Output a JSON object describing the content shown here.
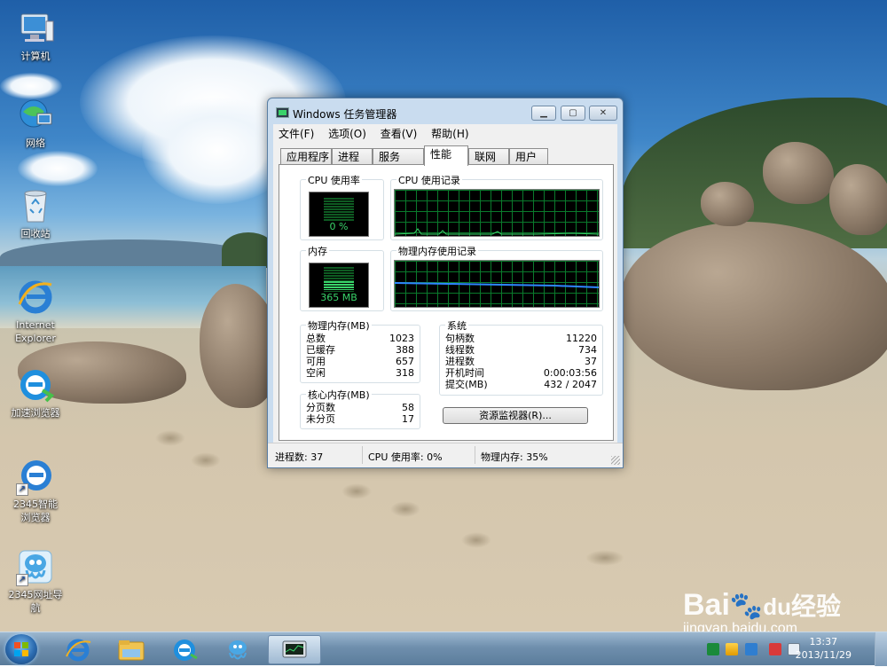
{
  "desktop": {
    "icons": [
      {
        "label": "计算机"
      },
      {
        "label": "网络"
      },
      {
        "label": "回收站"
      },
      {
        "label": "Internet Explorer"
      },
      {
        "label": "加速浏览器"
      },
      {
        "label": "2345智能浏览器"
      },
      {
        "label": "2345网址导航"
      }
    ]
  },
  "window": {
    "title": "Windows 任务管理器",
    "menu": [
      "文件(F)",
      "选项(O)",
      "查看(V)",
      "帮助(H)"
    ],
    "tabs": [
      "应用程序",
      "进程",
      "服务",
      "性能",
      "联网",
      "用户"
    ],
    "active_tab": "性能",
    "cpu_usage_label": "CPU 使用率",
    "cpu_usage_value": "0 %",
    "cpu_history_label": "CPU 使用记录",
    "memory_label": "内存",
    "memory_value": "365 MB",
    "memory_history_label": "物理内存使用记录",
    "physical_memory": {
      "title": "物理内存(MB)",
      "rows": [
        {
          "k": "总数",
          "v": "1023"
        },
        {
          "k": "已缓存",
          "v": "388"
        },
        {
          "k": "可用",
          "v": "657"
        },
        {
          "k": "空闲",
          "v": "318"
        }
      ]
    },
    "system": {
      "title": "系统",
      "rows": [
        {
          "k": "句柄数",
          "v": "11220"
        },
        {
          "k": "线程数",
          "v": "734"
        },
        {
          "k": "进程数",
          "v": "37"
        },
        {
          "k": "开机时间",
          "v": "0:00:03:56"
        },
        {
          "k": "提交(MB)",
          "v": "432 / 2047"
        }
      ]
    },
    "kernel_memory": {
      "title": "核心内存(MB)",
      "rows": [
        {
          "k": "分页数",
          "v": "58"
        },
        {
          "k": "未分页",
          "v": "17"
        }
      ]
    },
    "resource_monitor_button": "资源监视器(R)...",
    "status": {
      "processes": "进程数: 37",
      "cpu": "CPU 使用率: 0%",
      "memory": "物理内存: 35%"
    },
    "memory_fill_fraction": 0.35
  },
  "taskbar": {
    "time": "13:37",
    "date": "2013/11/29"
  },
  "watermark": {
    "brand": "Bai",
    "brand2": "经验",
    "url": "jingyan.baidu.com"
  },
  "colors": {
    "graph_green": "#39d36a",
    "memory_line": "#2e86ff",
    "window_frame": "#c9dcef"
  }
}
